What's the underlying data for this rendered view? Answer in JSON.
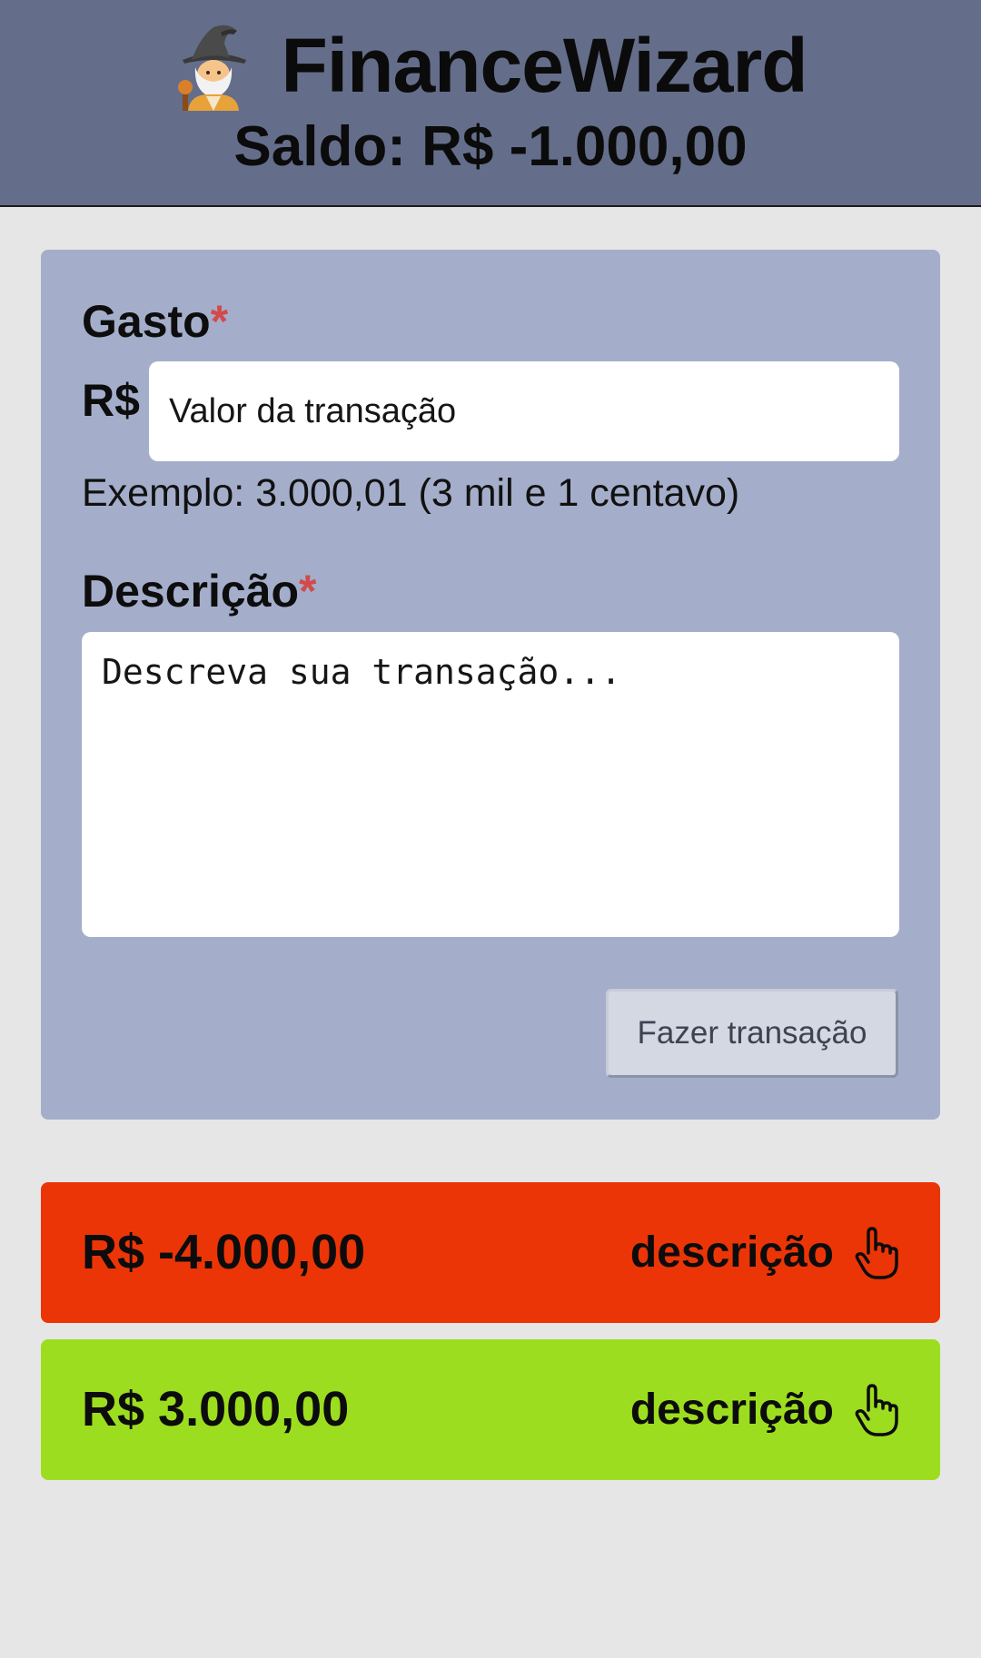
{
  "header": {
    "app_icon": "wizard-icon",
    "title": "FinanceWizard",
    "balance": "Saldo: R$ -1.000,00"
  },
  "form": {
    "amount_label": "Gasto",
    "required_mark": "*",
    "currency_prefix": "R$",
    "amount_placeholder": "Valor da transação",
    "amount_hint": "Exemplo: 3.000,01 (3 mil e 1 centavo)",
    "description_label": "Descrição",
    "description_placeholder": "Descreva sua transação...",
    "submit_label": "Fazer transação"
  },
  "transactions": [
    {
      "amount": "R$ -4.000,00",
      "description_link": "descrição",
      "icon": "pointer-hand-icon",
      "color": "#ec3507"
    },
    {
      "amount": "R$ 3.000,00",
      "description_link": "descrição",
      "icon": "pointer-hand-icon",
      "color": "#9ddd1f"
    }
  ],
  "colors": {
    "header_bg": "#646e8a",
    "card_bg": "#a4aeca",
    "page_bg": "#e6e6e7",
    "required": "#d24a4a"
  }
}
